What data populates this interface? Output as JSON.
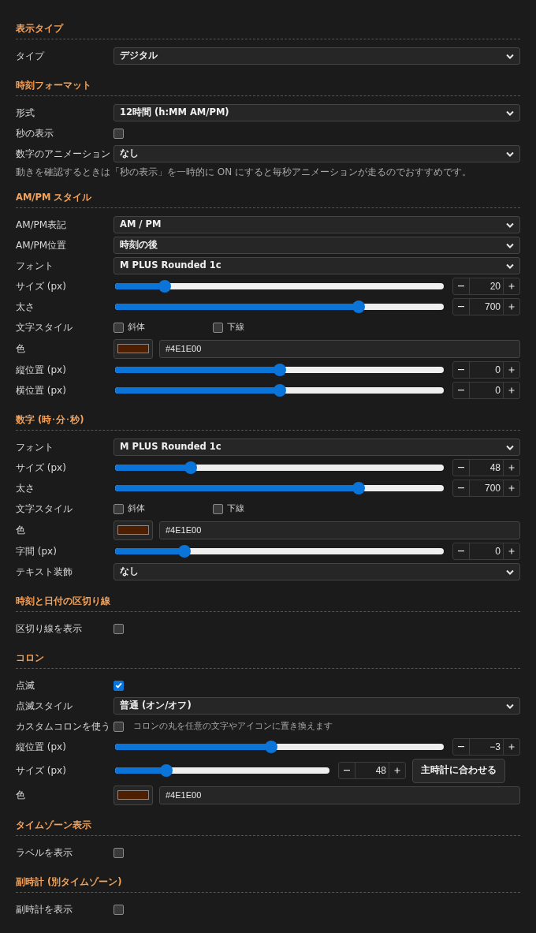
{
  "sections": [
    {
      "title": "表示タイプ",
      "rows": [
        {
          "kind": "select",
          "label": "タイプ",
          "value": "デジタル"
        }
      ]
    },
    {
      "title": "時刻フォーマット",
      "rows": [
        {
          "kind": "select",
          "label": "形式",
          "value": "12時間 (h:MM AM/PM)"
        },
        {
          "kind": "checkbox",
          "label": "秒の表示",
          "checked": false
        },
        {
          "kind": "select",
          "label": "数字のアニメーション",
          "value": "なし"
        },
        {
          "kind": "note",
          "text": "動きを確認するときは「秒の表示」を一時的に ON にすると毎秒アニメーションが走るのでおすすめです。"
        }
      ]
    },
    {
      "title": "AM/PM スタイル",
      "rows": [
        {
          "kind": "select",
          "label": "AM/PM表記",
          "value": "AM / PM"
        },
        {
          "kind": "select",
          "label": "AM/PM位置",
          "value": "時刻の後"
        },
        {
          "kind": "select",
          "label": "フォント",
          "value": "M PLUS Rounded 1c"
        },
        {
          "kind": "slider",
          "label": "サイズ (px)",
          "level": 0.15,
          "value": "20"
        },
        {
          "kind": "slider",
          "label": "太さ",
          "level": 0.74,
          "value": "700"
        },
        {
          "kind": "styles",
          "label": "文字スタイル",
          "options": [
            {
              "label": "斜体",
              "checked": false
            },
            {
              "label": "下線",
              "checked": false
            }
          ]
        },
        {
          "kind": "color",
          "label": "色",
          "color": "#4e1e00",
          "value": "#4E1E00"
        },
        {
          "kind": "slider",
          "label": "縦位置 (px)",
          "level": 0.5,
          "value": "0"
        },
        {
          "kind": "slider",
          "label": "横位置 (px)",
          "level": 0.5,
          "value": "0"
        }
      ]
    },
    {
      "title": "数字 (時･分･秒)",
      "rows": [
        {
          "kind": "select",
          "label": "フォント",
          "value": "M PLUS Rounded 1c"
        },
        {
          "kind": "slider",
          "label": "サイズ (px)",
          "level": 0.23,
          "value": "48"
        },
        {
          "kind": "slider",
          "label": "太さ",
          "level": 0.74,
          "value": "700"
        },
        {
          "kind": "styles",
          "label": "文字スタイル",
          "options": [
            {
              "label": "斜体",
              "checked": false
            },
            {
              "label": "下線",
              "checked": false
            }
          ]
        },
        {
          "kind": "color",
          "label": "色",
          "color": "#4e1e00",
          "value": "#4E1E00"
        },
        {
          "kind": "slider",
          "label": "字間 (px)",
          "level": 0.21,
          "value": "0"
        },
        {
          "kind": "select",
          "label": "テキスト装飾",
          "value": "なし"
        }
      ]
    },
    {
      "title": "時刻と日付の区切り線",
      "rows": [
        {
          "kind": "checkbox",
          "label": "区切り線を表示",
          "checked": false
        }
      ]
    },
    {
      "title": "コロン",
      "rows": [
        {
          "kind": "checkbox",
          "label": "点滅",
          "checked": true
        },
        {
          "kind": "select",
          "label": "点滅スタイル",
          "value": "普通 (オン/オフ)"
        },
        {
          "kind": "checkbox",
          "label": "カスタムコロンを使う",
          "checked": false,
          "hint": "コロンの丸を任意の文字やアイコンに置き換えます"
        },
        {
          "kind": "slider",
          "label": "縦位置 (px)",
          "level": 0.475,
          "value": "−3"
        },
        {
          "kind": "slider",
          "label": "サイズ (px)",
          "level": 0.24,
          "value": "48",
          "button": "主時計に合わせる"
        },
        {
          "kind": "color",
          "label": "色",
          "color": "#4e1e00",
          "value": "#4E1E00"
        }
      ]
    },
    {
      "title": "タイムゾーン表示",
      "rows": [
        {
          "kind": "checkbox",
          "label": "ラベルを表示",
          "checked": false
        }
      ]
    },
    {
      "title": "副時計 (別タイムゾーン)",
      "rows": [
        {
          "kind": "checkbox",
          "label": "副時計を表示",
          "checked": false
        }
      ]
    }
  ]
}
